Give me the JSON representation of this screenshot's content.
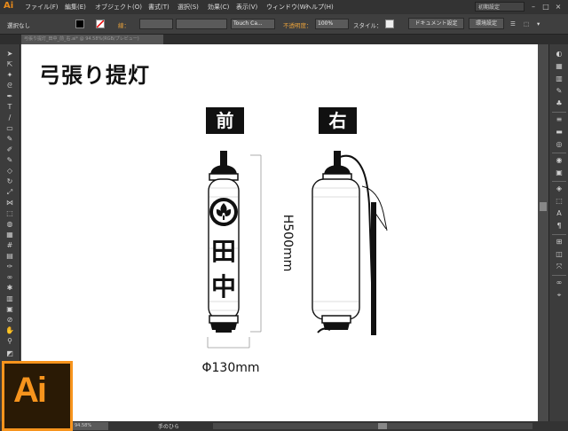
{
  "app": {
    "logo": "Ai"
  },
  "menu": {
    "items": [
      "ファイル(F)",
      "編集(E)",
      "オブジェクト(O)",
      "書式(T)",
      "選択(S)",
      "効果(C)",
      "表示(V)",
      "ウィンドウ(W)",
      "ヘルプ(H)"
    ],
    "workspace": "初期設定"
  },
  "control": {
    "selection": "選択なし",
    "stroke_label": "線：",
    "brush": "Touch Ca...",
    "opacity_label": "不透明度：",
    "opacity_value": "100%",
    "style_label": "スタイル：",
    "doc_setup": "ドキュメント設定",
    "prefs": "環境設定"
  },
  "document": {
    "tab": "弓張り提灯_田中_前_右.ai* @ 94.58%(RGB/プレビュー)"
  },
  "status": {
    "zoom": "94.58%",
    "tool": "手のひら"
  },
  "artboard": {
    "title": "弓張り提灯",
    "front_label": "前",
    "side_label": "右",
    "height_dim": "H500mm",
    "diameter_dim": "Φ130mm",
    "name_text": [
      "田",
      "中"
    ]
  },
  "colors": {
    "accent": "#f7941d",
    "canvas": "#ffffff",
    "ui_bg": "#535353"
  }
}
